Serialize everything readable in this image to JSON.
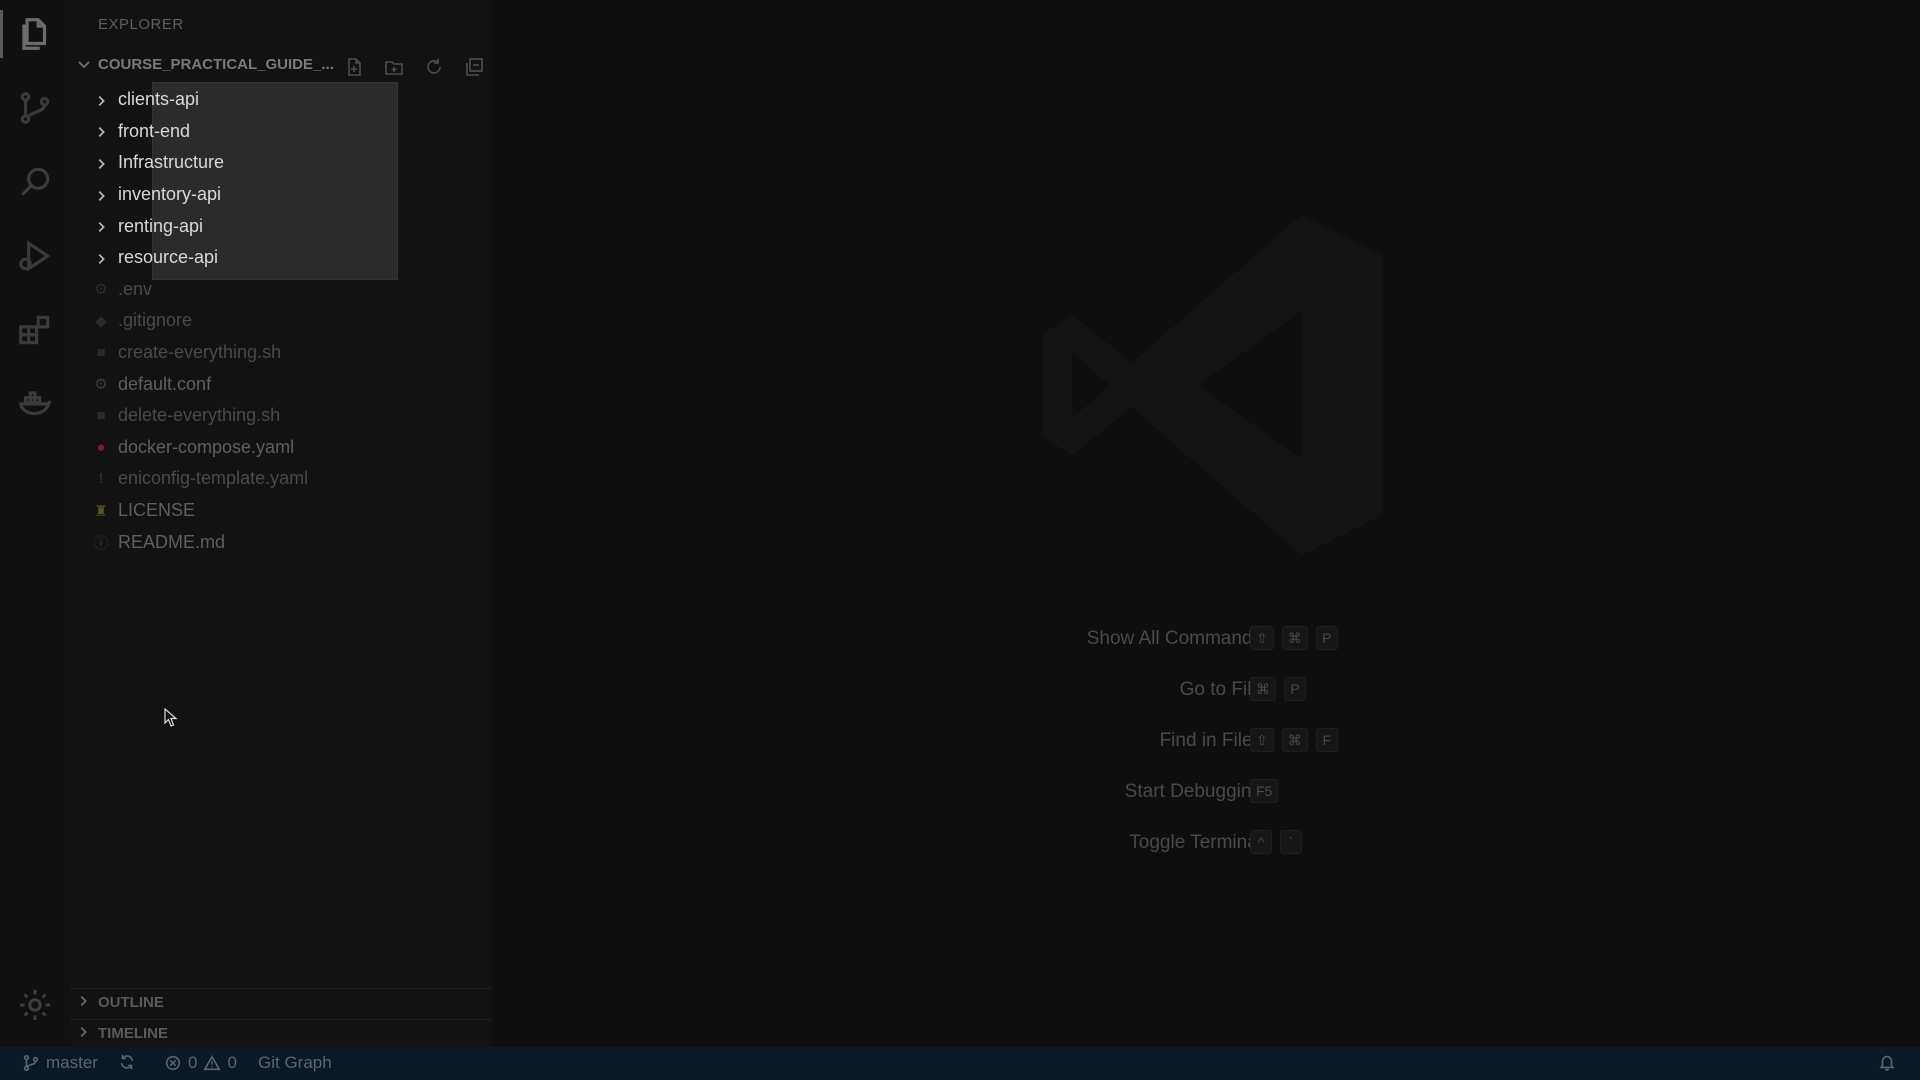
{
  "sidebar": {
    "title": "EXPLORER",
    "folder_name": "COURSE_PRACTICAL_GUIDE_...",
    "folders": [
      "clients-api",
      "front-end",
      "Infrastructure",
      "inventory-api",
      "renting-api",
      "resource-api"
    ],
    "files": [
      {
        "name": ".env",
        "icon": "gear-icon",
        "color": "#2d2d2d"
      },
      {
        "name": ".gitignore",
        "icon": "git-diamond-icon",
        "color": "#2d2d2d"
      },
      {
        "name": "create-everything.sh",
        "icon": "terminal-icon",
        "color": "#2d2d2d"
      },
      {
        "name": "default.conf",
        "icon": "gear-icon",
        "color": "#3a3a3a"
      },
      {
        "name": "delete-everything.sh",
        "icon": "terminal-icon",
        "color": "#2d2d2d"
      },
      {
        "name": "docker-compose.yaml",
        "icon": "docker-icon",
        "color": "#6e1d24"
      },
      {
        "name": "eniconfig-template.yaml",
        "icon": "exclamation-icon",
        "color": "#4a3c1d"
      },
      {
        "name": "LICENSE",
        "icon": "license-icon",
        "color": "#5b5520"
      },
      {
        "name": "README.md",
        "icon": "info-icon",
        "color": "#1f3b55"
      }
    ],
    "outline_label": "OUTLINE",
    "timeline_label": "TIMELINE"
  },
  "shortcuts": [
    {
      "label": "Show All Commands",
      "keys": [
        "⇧",
        "⌘",
        "P"
      ]
    },
    {
      "label": "Go to File",
      "keys": [
        "⌘",
        "P"
      ]
    },
    {
      "label": "Find in Files",
      "keys": [
        "⇧",
        "⌘",
        "F"
      ]
    },
    {
      "label": "Start Debugging",
      "keys": [
        "F5"
      ]
    },
    {
      "label": "Toggle Terminal",
      "keys": [
        "^",
        "`"
      ]
    }
  ],
  "statusbar": {
    "branch": "master",
    "errors": "0",
    "warnings": "0",
    "git_graph": "Git Graph"
  }
}
